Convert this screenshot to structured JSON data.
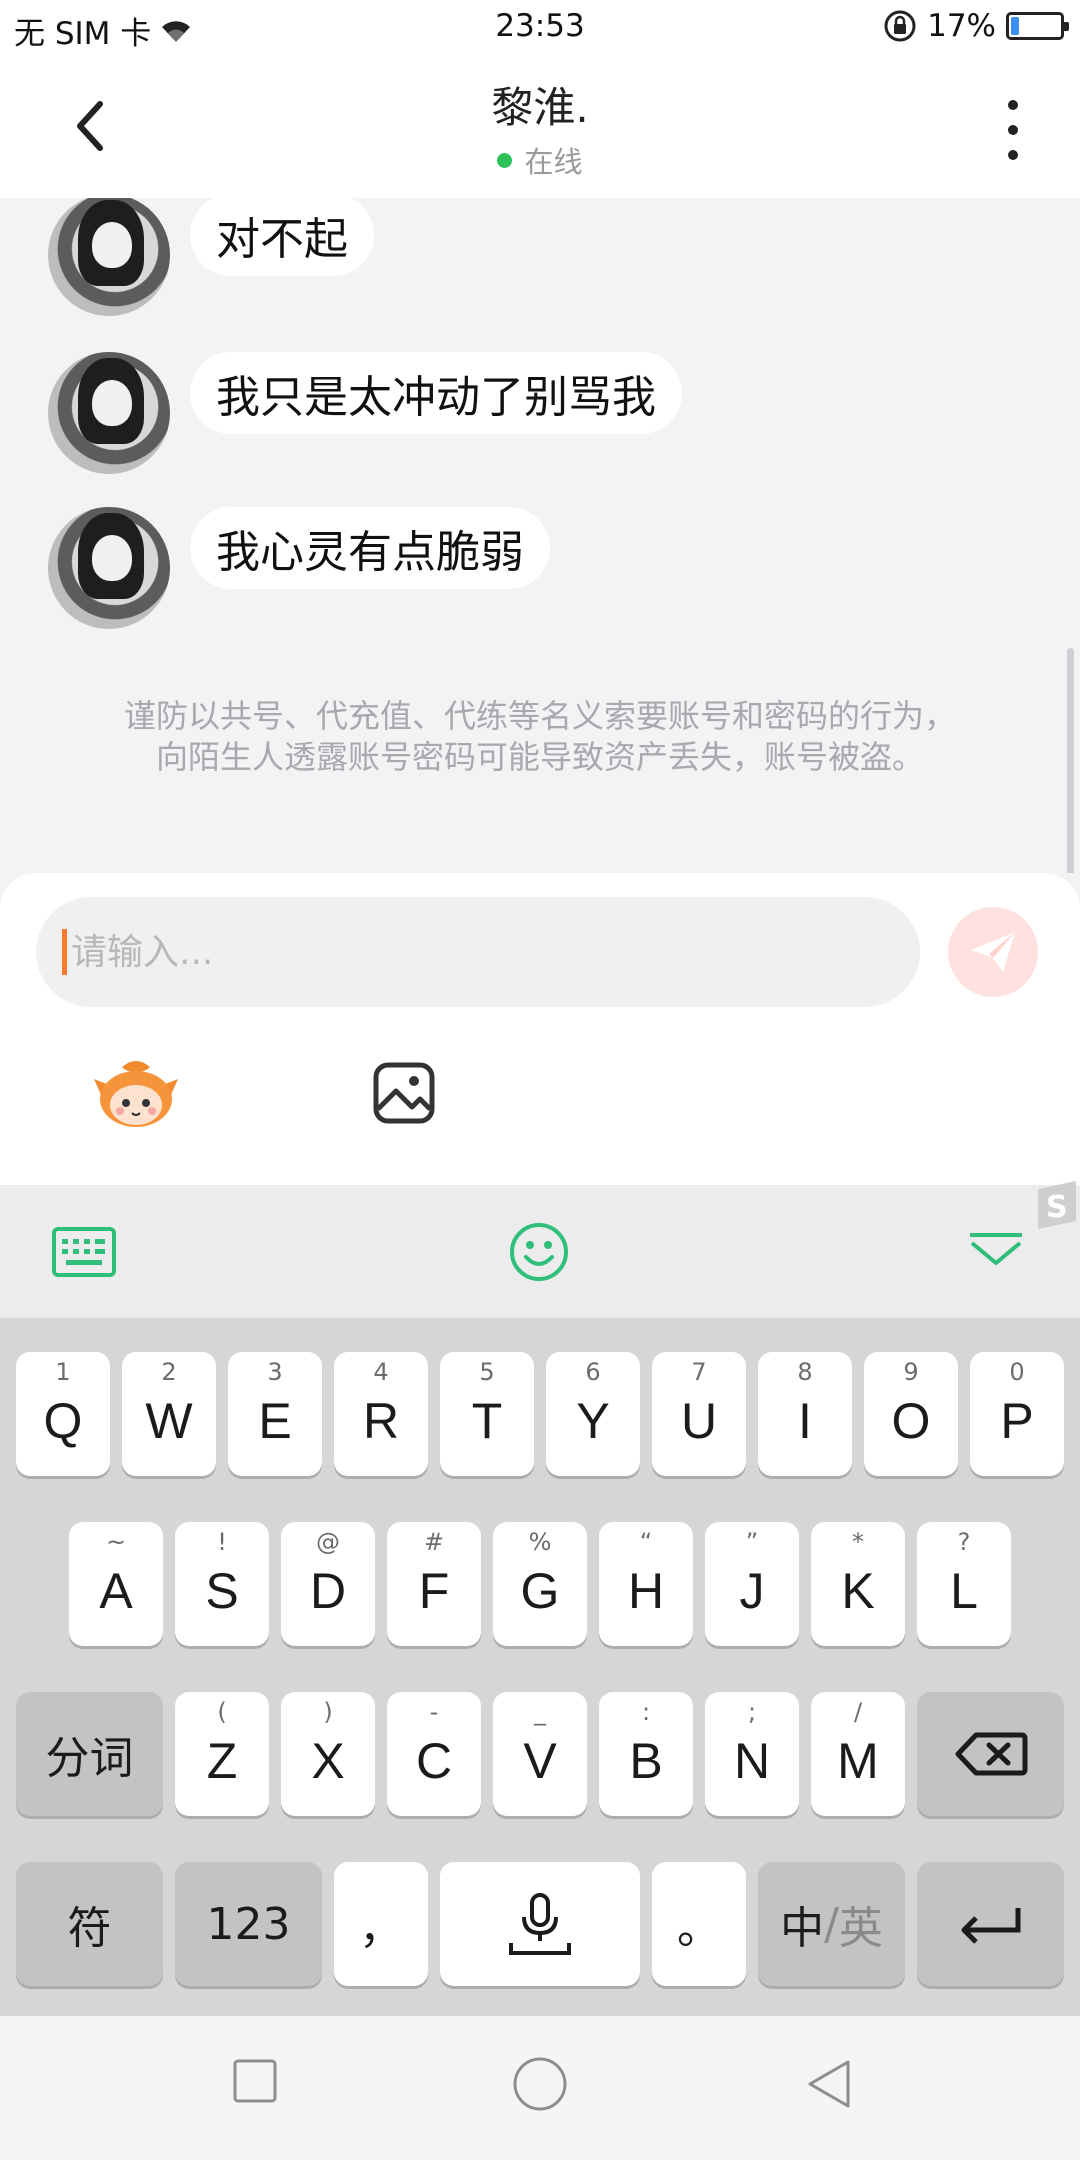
{
  "status_bar": {
    "carrier": "无 SIM 卡",
    "time": "23:53",
    "battery_percent": "17%",
    "battery_level": 0.17
  },
  "header": {
    "title": "黎淮.",
    "status": "在线"
  },
  "messages": [
    {
      "text": "对不起"
    },
    {
      "text": "我只是太冲动了别骂我"
    },
    {
      "text": "我心灵有点脆弱"
    }
  ],
  "notice": "谨防以共号、代充值、代练等名义索要账号和密码的行为，向陌生人透露账号密码可能导致资产丢失，账号被盗。",
  "composer": {
    "placeholder": "请输入..."
  },
  "keyboard": {
    "row1": [
      {
        "main": "Q",
        "sub": "1"
      },
      {
        "main": "W",
        "sub": "2"
      },
      {
        "main": "E",
        "sub": "3"
      },
      {
        "main": "R",
        "sub": "4"
      },
      {
        "main": "T",
        "sub": "5"
      },
      {
        "main": "Y",
        "sub": "6"
      },
      {
        "main": "U",
        "sub": "7"
      },
      {
        "main": "I",
        "sub": "8"
      },
      {
        "main": "O",
        "sub": "9"
      },
      {
        "main": "P",
        "sub": "0"
      }
    ],
    "row2": [
      {
        "main": "A",
        "sub": "~"
      },
      {
        "main": "S",
        "sub": "!"
      },
      {
        "main": "D",
        "sub": "@"
      },
      {
        "main": "F",
        "sub": "#"
      },
      {
        "main": "G",
        "sub": "%"
      },
      {
        "main": "H",
        "sub": "“"
      },
      {
        "main": "J",
        "sub": "”"
      },
      {
        "main": "K",
        "sub": "*"
      },
      {
        "main": "L",
        "sub": "?"
      }
    ],
    "row3": [
      {
        "main": "Z",
        "sub": "("
      },
      {
        "main": "X",
        "sub": ")"
      },
      {
        "main": "C",
        "sub": "-"
      },
      {
        "main": "V",
        "sub": "_"
      },
      {
        "main": "B",
        "sub": ":"
      },
      {
        "main": "N",
        "sub": ";"
      },
      {
        "main": "M",
        "sub": "/"
      }
    ],
    "segment_label": "分词",
    "symbol_label": "符",
    "numbers_label": "123",
    "comma_label": "，",
    "period_label": "。",
    "lang_zh": "中",
    "lang_sep": "/",
    "lang_en": "英"
  }
}
